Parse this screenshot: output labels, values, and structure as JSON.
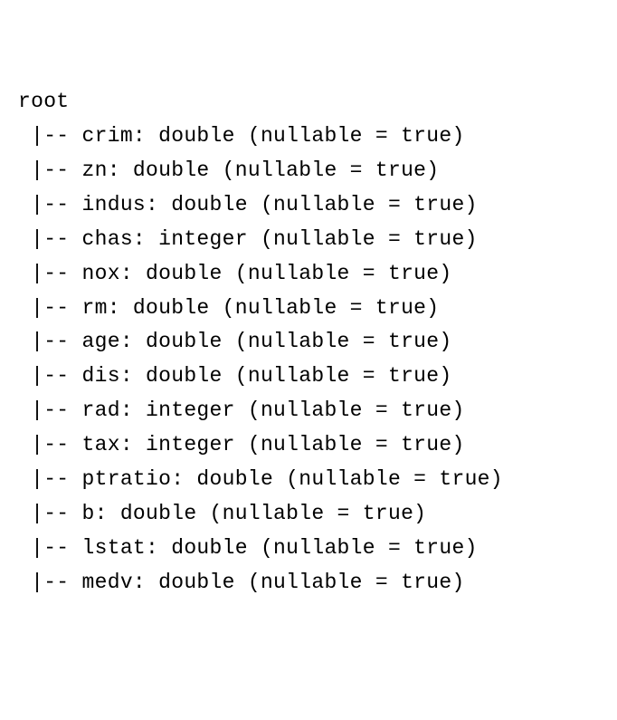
{
  "root_label": "root",
  "prefix": " |-- ",
  "nullable_text": "(nullable = true)",
  "fields": [
    {
      "name": "crim",
      "type": "double"
    },
    {
      "name": "zn",
      "type": "double"
    },
    {
      "name": "indus",
      "type": "double"
    },
    {
      "name": "chas",
      "type": "integer"
    },
    {
      "name": "nox",
      "type": "double"
    },
    {
      "name": "rm",
      "type": "double"
    },
    {
      "name": "age",
      "type": "double"
    },
    {
      "name": "dis",
      "type": "double"
    },
    {
      "name": "rad",
      "type": "integer"
    },
    {
      "name": "tax",
      "type": "integer"
    },
    {
      "name": "ptratio",
      "type": "double"
    },
    {
      "name": "b",
      "type": "double"
    },
    {
      "name": "lstat",
      "type": "double"
    },
    {
      "name": "medv",
      "type": "double"
    }
  ]
}
